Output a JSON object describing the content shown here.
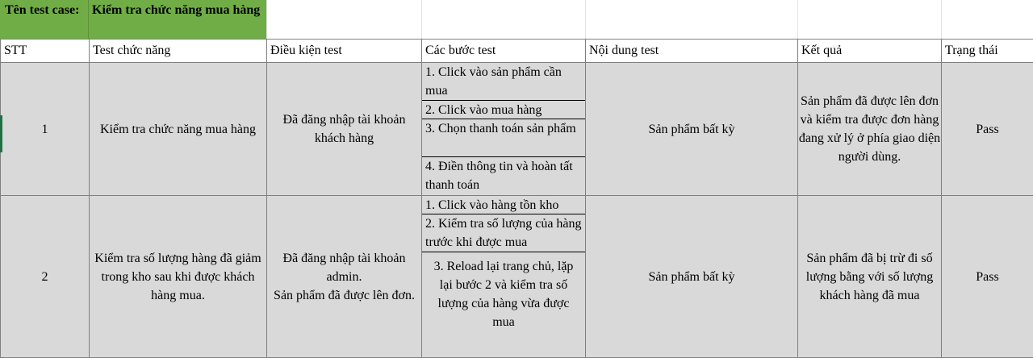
{
  "test_case": {
    "label": "Tên test case:",
    "value": "Kiểm tra chức năng mua hàng"
  },
  "headers": [
    "STT",
    "Test chức năng",
    "Điều kiện test",
    "Các bước test",
    "Nội dung test",
    "Kết quả",
    "Trạng thái"
  ],
  "rows": [
    {
      "stt": "1",
      "function": "Kiểm tra chức năng mua hàng",
      "condition": "Đã đăng nhập tài khoản khách hàng",
      "steps": [
        "1. Click vào sản phẩm cần mua",
        "2. Click vào mua hàng",
        "3. Chọn thanh toán sản phẩm",
        "4. Điền thông tin và hoàn tất thanh toán"
      ],
      "content": "Sản phẩm bất kỳ",
      "result": "Sản phẩm đã được lên đơn và kiểm tra được đơn hàng đang xử lý ở phía giao diện người dùng.",
      "status": "Pass"
    },
    {
      "stt": "2",
      "function": "Kiểm tra số lượng hàng đã giảm trong kho sau khi được khách hàng mua.",
      "condition_lines": [
        "Đã đăng nhập tài khoản admin.",
        "Sản phẩm đã được lên đơn."
      ],
      "steps": [
        "1. Click vào hàng tồn kho",
        "2. Kiểm tra số lượng của hàng trước khi được mua",
        "3. Reload lại trang chủ, lặp lại bước 2 và kiểm tra số lượng của hàng vừa được mua"
      ],
      "content": "Sản phẩm bất kỳ",
      "result": "Sản phẩm đã bị trừ đi số lượng bằng với số lượng khách hàng đã mua",
      "status": "Pass"
    }
  ]
}
